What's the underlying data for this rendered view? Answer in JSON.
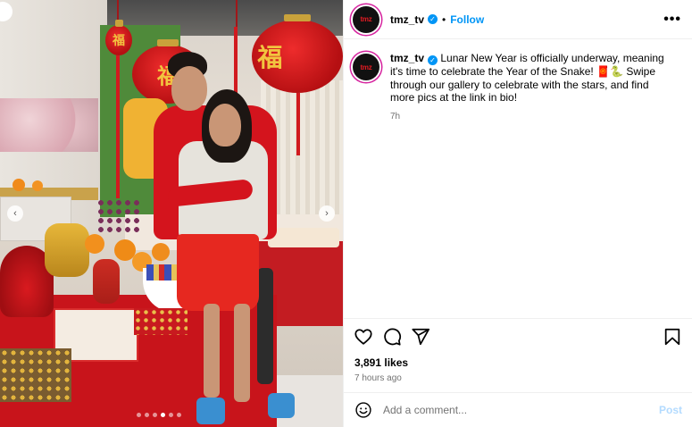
{
  "post": {
    "username": "tmz_tv",
    "avatar_text": "tmz",
    "follow_label": "Follow",
    "separator": "•",
    "more_label": "•••",
    "verified_mark": "✓",
    "caption": "Lunar New Year is officially underway, meaning it's time to celebrate the Year of the Snake! 🧧🐍 Swipe through our gallery to celebrate with the stars, and find more pics at the link in bio!",
    "caption_time": "7h",
    "likes": "3,891 likes",
    "time_ago": "7 hours ago",
    "comment_placeholder": "Add a comment...",
    "post_label": "Post"
  },
  "media": {
    "lantern_char": "福",
    "prev_arrow": "‹",
    "next_arrow": "›",
    "carousel_total": 6,
    "carousel_active": 4
  },
  "colors": {
    "link": "#0095f6",
    "post_disabled": "#b3dbff",
    "secondary_text": "#737373",
    "story_ring": "#d6249f",
    "lantern_red": "#d11a1f"
  },
  "icons": [
    "heart-icon",
    "comment-icon",
    "share-icon",
    "bookmark-icon",
    "emoji-icon",
    "verified-icon",
    "more-icon"
  ]
}
